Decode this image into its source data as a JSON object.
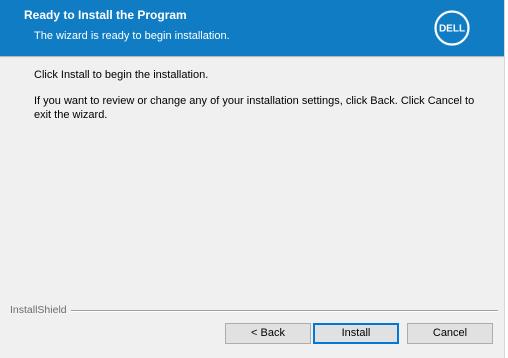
{
  "banner": {
    "title": "Ready to Install the Program",
    "subtitle": "The wizard is ready to begin installation.",
    "logo_text": "DELL",
    "color": "#0f7cc4"
  },
  "content": {
    "line1": "Click Install to begin the installation.",
    "line2": "If you want to review or change any of your installation settings, click Back. Click Cancel to exit the wizard."
  },
  "footer": {
    "brand": "InstallShield",
    "buttons": {
      "back": "< Back",
      "install": "Install",
      "cancel": "Cancel"
    }
  }
}
